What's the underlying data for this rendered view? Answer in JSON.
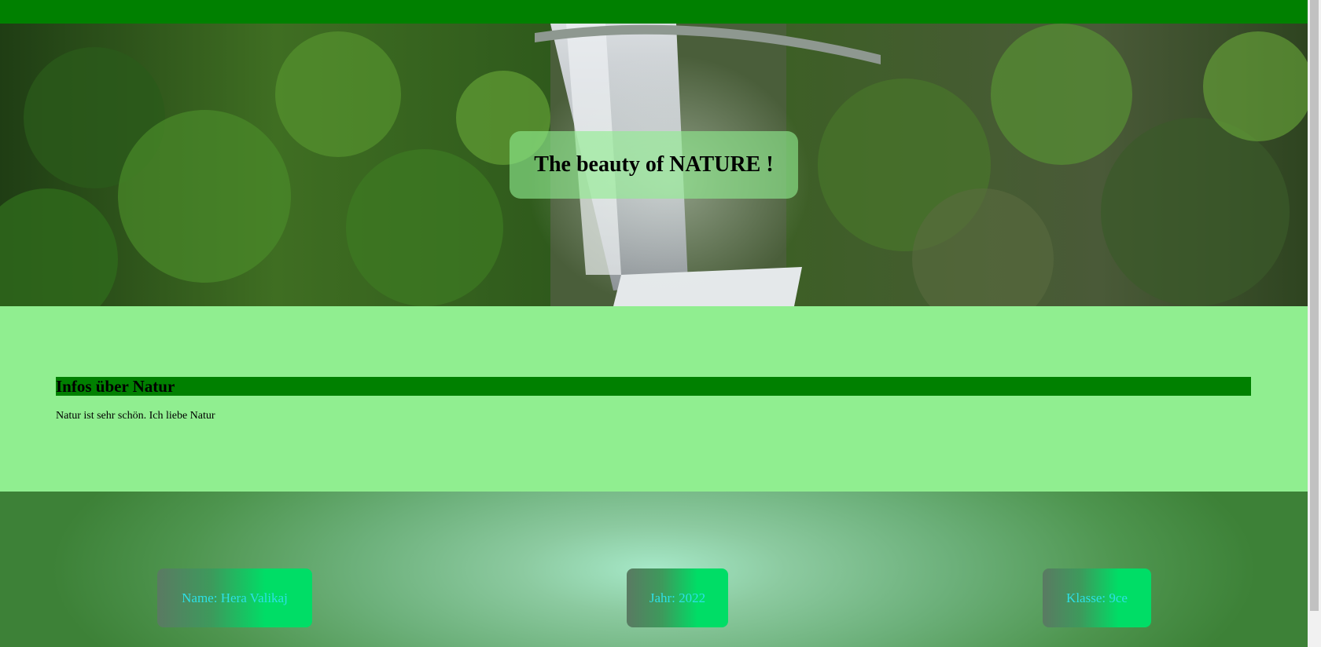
{
  "hero": {
    "title": "The beauty of NATURE !",
    "image_subject": "waterfall"
  },
  "info": {
    "heading": "Infos über Natur",
    "text": "Natur ist sehr schön. Ich liebe Natur"
  },
  "footer": {
    "name": "Name: Hera Valikaj",
    "year": "Jahr: 2022",
    "class": "Klasse: 9ce"
  },
  "colors": {
    "topbar": "#008000",
    "info_background": "#90ee90",
    "heading_background": "#008000",
    "card_text": "#2de0e6",
    "card_accent": "#00dd66"
  }
}
